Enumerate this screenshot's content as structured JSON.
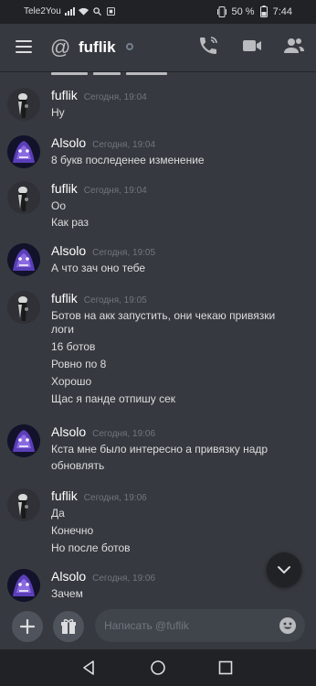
{
  "status_bar": {
    "carrier": "Tele2You",
    "battery": "50 %",
    "time": "7:44"
  },
  "header": {
    "title": "fuflik",
    "icons": [
      "menu-icon",
      "at-icon",
      "status-offline-icon",
      "phone-call-icon",
      "video-call-icon",
      "members-icon"
    ]
  },
  "messages": [
    {
      "author": "fuflik",
      "timestamp": "Сегодня, 19:04",
      "lines": [
        "Ну"
      ]
    },
    {
      "author": "Alsolo",
      "timestamp": "Сегодня, 19:04",
      "lines": [
        "8 букв последенее изменение"
      ]
    },
    {
      "author": "fuflik",
      "timestamp": "Сегодня, 19:04",
      "lines": [
        "Оо",
        "Как раз"
      ]
    },
    {
      "author": "Alsolo",
      "timestamp": "Сегодня, 19:05",
      "lines": [
        "А что зач оно тебе"
      ]
    },
    {
      "author": "fuflik",
      "timestamp": "Сегодня, 19:05",
      "lines": [
        "Ботов на акк запустить, они чекаю привязки",
        "логи",
        "16 ботов",
        "Ровно по 8",
        "Хорошо",
        "Щас я панде отпишу сек"
      ]
    },
    {
      "author": "Alsolo",
      "timestamp": "Сегодня, 19:06",
      "lines": [
        "Кста мне было интересно а привязку надр",
        "обновлять"
      ]
    },
    {
      "author": "fuflik",
      "timestamp": "Сегодня, 19:06",
      "lines": [
        "Да",
        "Конечно",
        "Но после ботов"
      ]
    },
    {
      "author": "Alsolo",
      "timestamp": "Сегодня, 19:06",
      "lines": [
        "Зачем"
      ]
    }
  ],
  "composer": {
    "placeholder": "Написать @fuflik"
  },
  "colors": {
    "background": "#36393f",
    "header_bar": "#202225",
    "input": "#40444b",
    "timestamp": "#72767d"
  }
}
